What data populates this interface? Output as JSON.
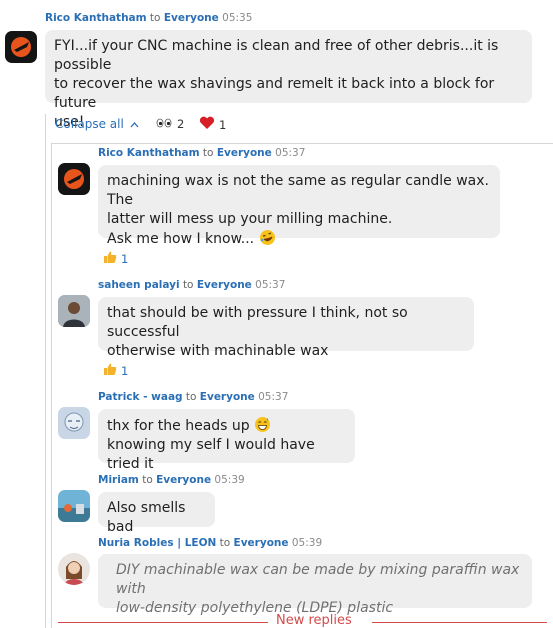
{
  "main_message": {
    "author": "Rico Kanthatham",
    "to_word": "to",
    "recipient": "Everyone",
    "time": "05:35",
    "text_l1": "FYI...if your CNC machine is clean and free of other debris...it is possible",
    "text_l2": "to recover the wax shavings and remelt it back into a block for future",
    "text_l3": "use!"
  },
  "thread_bar": {
    "collapse_label": "Collapse all",
    "eyes_count": "2",
    "heart_count": "1"
  },
  "replies": [
    {
      "author": "Rico Kanthatham",
      "to_word": "to",
      "recipient": "Everyone",
      "time": "05:37",
      "line1": "machining wax is not the same as regular candle wax. The",
      "line2": "latter will mess up your milling machine.",
      "line3": "Ask me how I know...",
      "thumbs_count": "1"
    },
    {
      "author": "saheen palayi",
      "to_word": "to",
      "recipient": "Everyone",
      "time": "05:37",
      "line1": "that should be with pressure I think, not so successful",
      "line2": "otherwise with machinable wax",
      "thumbs_count": "1"
    },
    {
      "author": "Patrick - waag",
      "to_word": "to",
      "recipient": "Everyone",
      "time": "05:37",
      "line1": "thx for the heads up",
      "line2": "knowing my self I would have tried it"
    },
    {
      "author": "Miriam",
      "to_word": "to",
      "recipient": "Everyone",
      "time": "05:39",
      "line1": "Also smells bad"
    },
    {
      "author": "Nuria Robles | LEON",
      "to_word": "to",
      "recipient": "Everyone",
      "time": "05:39",
      "line1": "DIY machinable wax can be made by mixing paraffin wax with",
      "line2": "low-density polyethylene (LDPE) plastic"
    }
  ],
  "divider": {
    "label": "New replies"
  },
  "colors": {
    "accent": "#2a6fb5",
    "bubble": "#eeeeef",
    "divider": "#d24b4b"
  }
}
